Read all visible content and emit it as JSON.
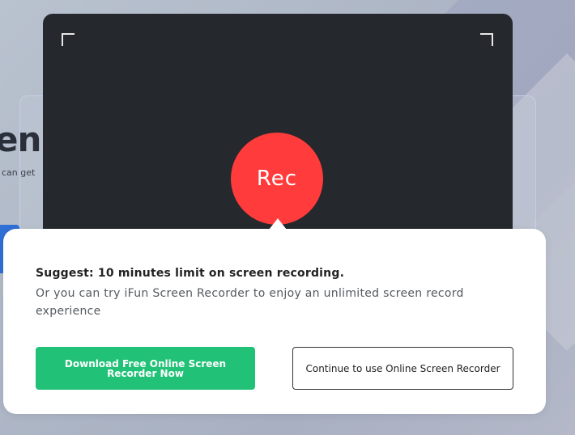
{
  "background": {
    "heading_fragment": "en",
    "subtext_fragment": "can get"
  },
  "recorder": {
    "rec_label": "Rec"
  },
  "dialog": {
    "title": "Suggest: 10 minutes limit on screen recording.",
    "body": "Or you can try iFun Screen Recorder to enjoy an unlimited screen record experience",
    "download_button": "Download Free Online Screen Recorder Now",
    "continue_button": "Continue to use Online Screen Recorder"
  },
  "colors": {
    "rec_red": "#ff3b3b",
    "download_green": "#22c178",
    "recorder_bg": "#25282c"
  }
}
